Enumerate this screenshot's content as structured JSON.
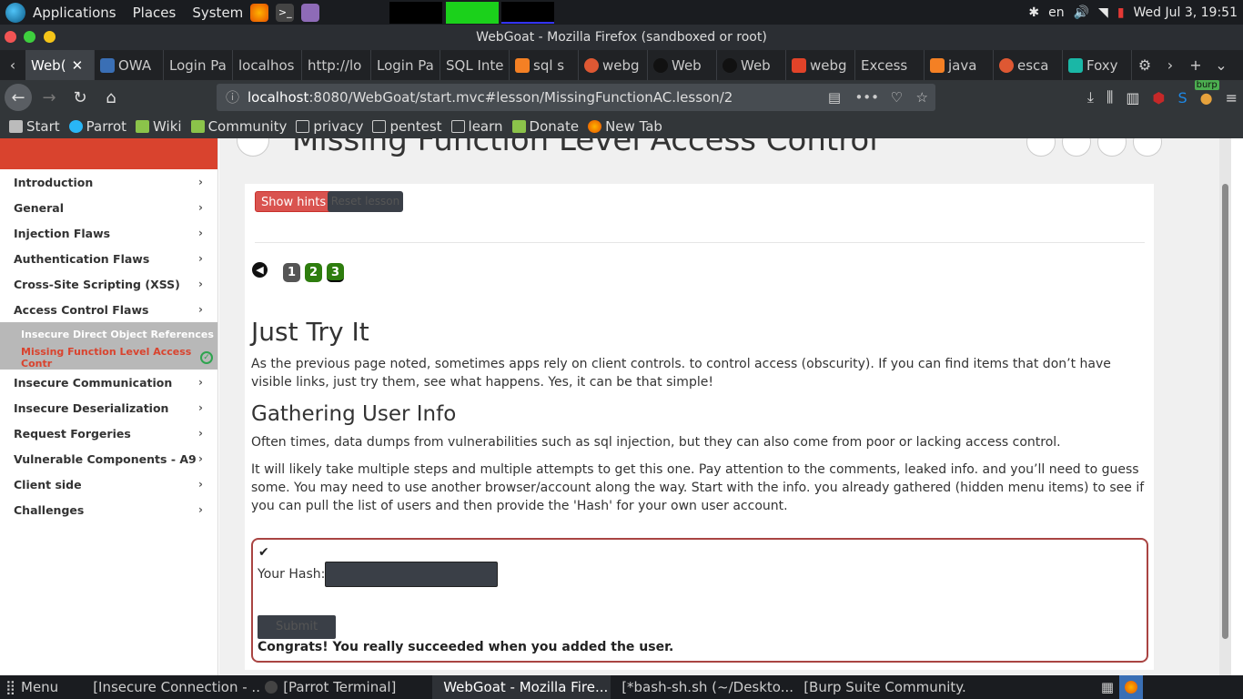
{
  "system_panel": {
    "menus": [
      "Applications",
      "Places",
      "System"
    ],
    "lang": "en",
    "clock": "Wed Jul 3, 19:51"
  },
  "window": {
    "title": "WebGoat - Mozilla Firefox (sandboxed or root)"
  },
  "tabs": [
    {
      "label": "Web(",
      "active": true
    },
    {
      "label": "OWA"
    },
    {
      "label": "Login Pa"
    },
    {
      "label": "localhos"
    },
    {
      "label": "http://lo"
    },
    {
      "label": "Login Pa"
    },
    {
      "label": "SQL Inte"
    },
    {
      "label": "sql s"
    },
    {
      "label": "webg"
    },
    {
      "label": "Web"
    },
    {
      "label": "Web"
    },
    {
      "label": "webg"
    },
    {
      "label": "Excess"
    },
    {
      "label": "java"
    },
    {
      "label": "esca"
    },
    {
      "label": "Foxy"
    }
  ],
  "url": {
    "host": "localhost",
    "rest": ":8080/WebGoat/start.mvc#lesson/MissingFunctionAC.lesson/2"
  },
  "bookmarks": [
    "Start",
    "Parrot",
    "Wiki",
    "Community",
    "privacy",
    "pentest",
    "learn",
    "Donate",
    "New Tab"
  ],
  "burp_badge": "burp",
  "sidebar": {
    "items": [
      "Introduction",
      "General",
      "Injection Flaws",
      "Authentication Flaws",
      "Cross-Site Scripting (XSS)",
      "Access Control Flaws",
      "Insecure Communication",
      "Insecure Deserialization",
      "Request Forgeries",
      "Vulnerable Components - A9",
      "Client side",
      "Challenges"
    ],
    "subitems": [
      "Insecure Direct Object References",
      "Missing Function Level Access Contr"
    ]
  },
  "page": {
    "title": "Missing Function Level Access Control",
    "show_hints": "Show hints",
    "reset_lesson": "Reset lesson",
    "pages": [
      "1",
      "2",
      "3"
    ],
    "h_try": "Just Try It",
    "p_try": "As the previous page noted, sometimes apps rely on client controls. to control access (obscurity). If you can find items that don’t have visible links, just try them, see what happens. Yes, it can be that simple!",
    "h_gather": "Gathering User Info",
    "p_gather1": "Often times, data dumps from vulnerabilities such as sql injection, but they can also come from poor or lacking access control.",
    "p_gather2": "It will likely take multiple steps and multiple attempts to get this one. Pay attention to the comments, leaked info. and you’ll need to guess some. You may need to use another browser/account along the way. Start with the info. you already gathered (hidden menu items) to see if you can pull the list of users and then provide the 'Hash' for your own user account.",
    "hash_label": "Your Hash:",
    "submit": "Submit",
    "congrats": "Congrats! You really succeeded when you added the user."
  },
  "taskbar": {
    "menu": "Menu",
    "tasks": [
      "[Insecure Connection - ...",
      "[Parrot Terminal]",
      "WebGoat - Mozilla Fire...",
      "[*bash-sh.sh (~/Deskto...",
      "[Burp Suite Community..."
    ]
  }
}
